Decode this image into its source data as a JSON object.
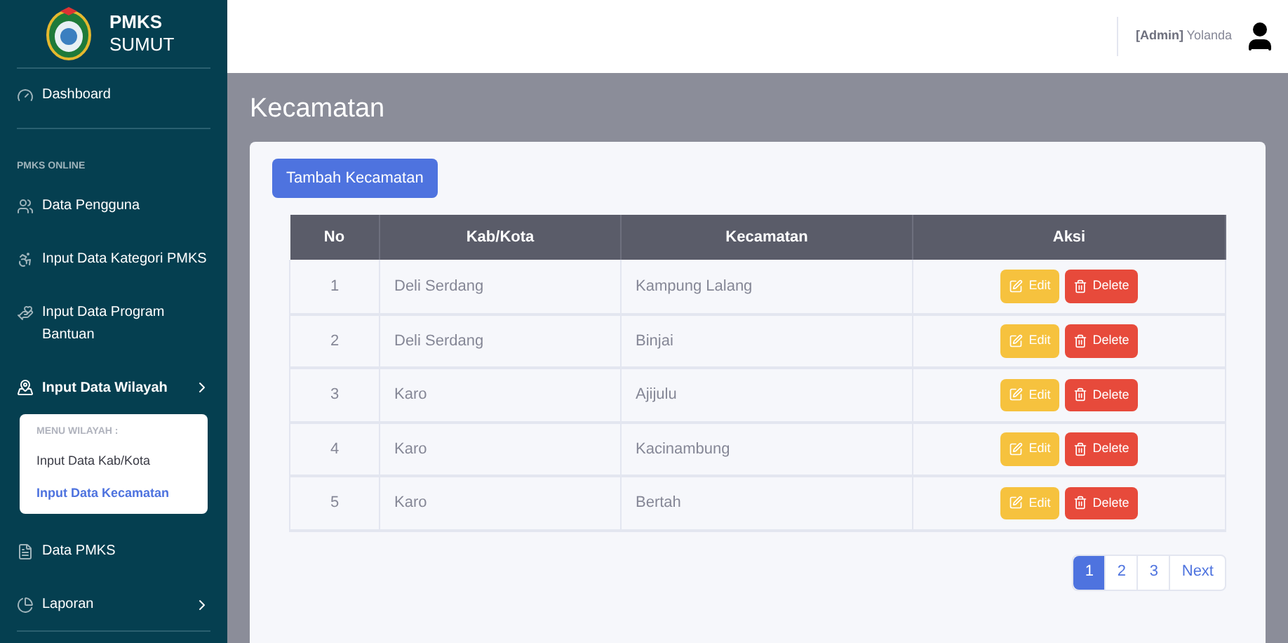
{
  "brand": {
    "line1": "PMKS",
    "line2": "SUMUT"
  },
  "sidebar": {
    "items": [
      {
        "kind": "link",
        "label": "Dashboard"
      },
      {
        "kind": "heading",
        "label": "PMKS ONLINE"
      },
      {
        "kind": "link",
        "label": "Data Pengguna"
      },
      {
        "kind": "link",
        "label": "Input Data Kategori PMKS"
      },
      {
        "kind": "link",
        "label": "Input Data Program Bantuan"
      },
      {
        "kind": "group",
        "label": "Input Data Wilayah",
        "expanded": true,
        "submenu": {
          "heading": "MENU WILAYAH :",
          "items": [
            {
              "label": "Input Data Kab/Kota",
              "selected": false
            },
            {
              "label": "Input Data Kecamatan",
              "selected": true
            }
          ]
        }
      },
      {
        "kind": "link",
        "label": "Data PMKS"
      },
      {
        "kind": "group",
        "label": "Laporan",
        "expanded": false
      }
    ]
  },
  "topbar": {
    "user_role": "[Admin]",
    "user_name": "Yolanda"
  },
  "page_title": "Kecamatan",
  "add_button": "Tambah Kecamatan",
  "table": {
    "columns": [
      "No",
      "Kab/Kota",
      "Kecamatan",
      "Aksi"
    ],
    "rows": [
      {
        "no": "1",
        "kab_kota": "Deli Serdang",
        "kecamatan": "Kampung Lalang",
        "actions": [
          "Edit",
          "Delete"
        ]
      },
      {
        "no": "2",
        "kab_kota": "Deli Serdang",
        "kecamatan": "Binjai",
        "actions": [
          "Edit",
          "Delete"
        ]
      },
      {
        "no": "3",
        "kab_kota": "Karo",
        "kecamatan": "Ajijulu",
        "actions": [
          "Edit",
          "Delete"
        ]
      },
      {
        "no": "4",
        "kab_kota": "Karo",
        "kecamatan": "Kacinambung",
        "actions": [
          "Edit",
          "Delete"
        ]
      },
      {
        "no": "5",
        "kab_kota": "Karo",
        "kecamatan": "Bertah",
        "actions": [
          "Edit",
          "Delete"
        ]
      }
    ]
  },
  "pagination": {
    "pages": [
      {
        "label": "1",
        "selected": true
      },
      {
        "label": "2",
        "selected": false
      },
      {
        "label": "3",
        "selected": false
      }
    ],
    "next": "Next"
  }
}
